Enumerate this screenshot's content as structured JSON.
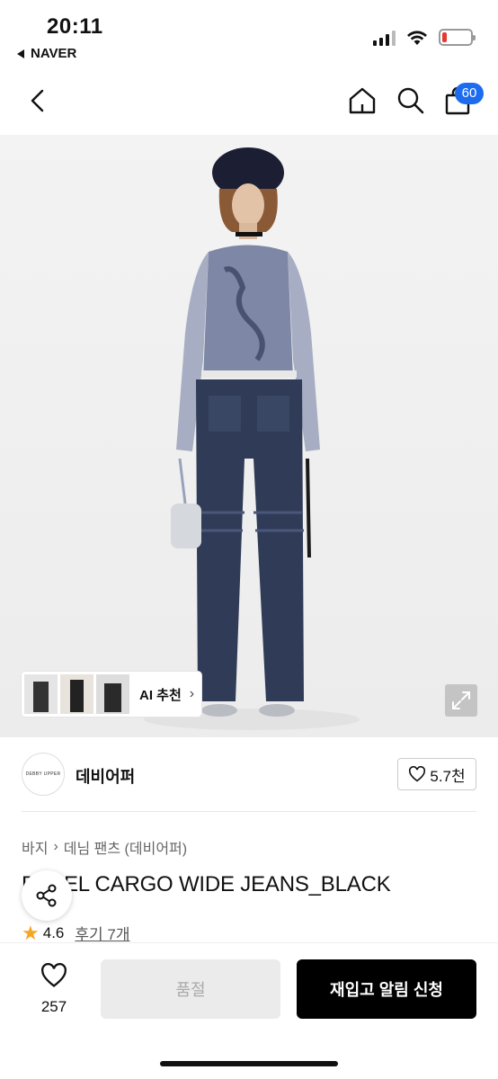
{
  "status_bar": {
    "time": "20:11",
    "back_app": "NAVER",
    "battery_level": 0.15
  },
  "nav": {
    "cart_count": "60",
    "icons": [
      "back-chevron-icon",
      "home-icon",
      "search-icon",
      "shopping-bag-icon"
    ]
  },
  "product_image": {
    "ai_recommend_label": "AI 추천",
    "colors": {
      "background": "#f0f0f0",
      "top": "#8a93ad",
      "jeans": "#2e3a55"
    }
  },
  "brand": {
    "logo_text": "DEBBY UPPER",
    "name": "데비어퍼",
    "like_count": "5.7천"
  },
  "breadcrumb": [
    "바지",
    "데님 팬츠 (데비어퍼)"
  ],
  "product": {
    "title": "PANEL CARGO WIDE JEANS_BLACK",
    "rating": "4.6",
    "review_label": "후기 7개"
  },
  "bottom_bar": {
    "like_count": "257",
    "soldout_label": "품절",
    "restock_label": "재입고 알림 신청",
    "accent": "#000000"
  }
}
